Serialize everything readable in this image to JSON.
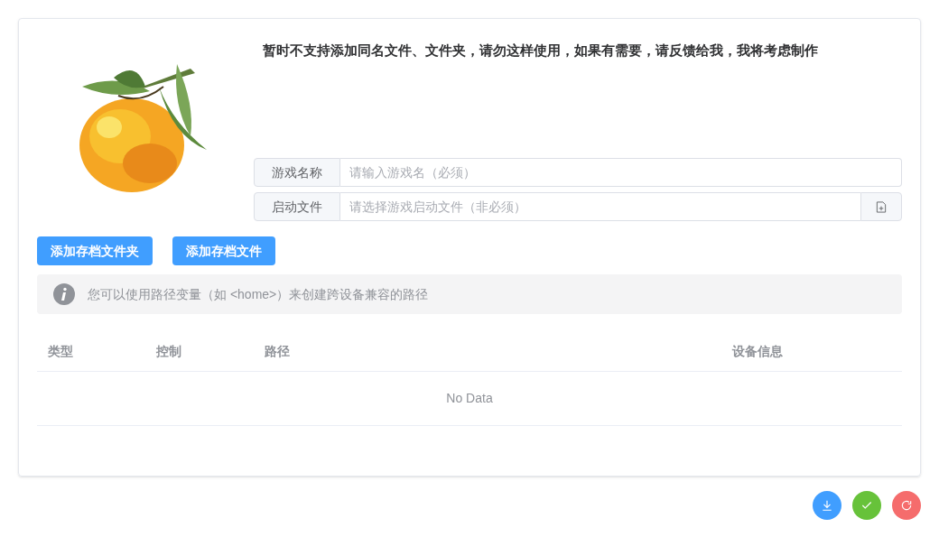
{
  "notice": "暂时不支持添加同名文件、文件夹，请勿这样使用，如果有需要，请反馈给我，我将考虑制作",
  "cover": {
    "kind": "picture"
  },
  "fields": [
    {
      "label": "游戏名称",
      "placeholder": "请输入游戏名（必须）",
      "kind": "text"
    },
    {
      "label": "启动文件",
      "placeholder": "请选择游戏启动文件（非必须）",
      "kind": "file"
    }
  ],
  "buttons": [
    "添加存档文件夹",
    "添加存档文件"
  ],
  "alert": "您可以使用路径变量（如 <home>）来创建跨设备兼容的路径",
  "table": {
    "columns": [
      "类型",
      "控制",
      "路径",
      "设备信息"
    ],
    "empty_text": "No Data"
  },
  "actions": [
    {
      "kind": "download",
      "color": "#409eff"
    },
    {
      "kind": "confirm",
      "color": "#67c23a"
    },
    {
      "kind": "reset",
      "color": "#f56c6c"
    }
  ]
}
